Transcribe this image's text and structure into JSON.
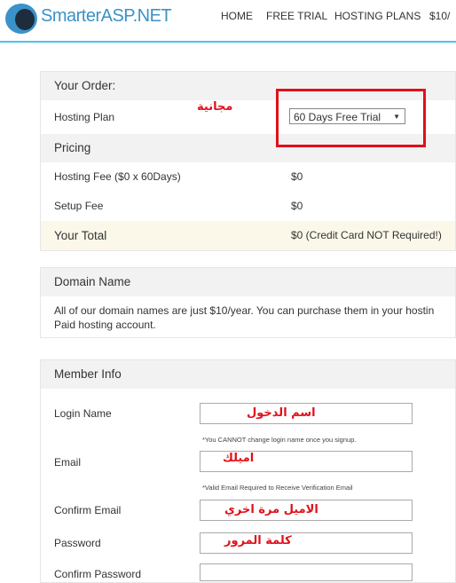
{
  "header": {
    "brand": "SmarterASP.NET",
    "nav": [
      "HOME",
      "FREE TRIAL",
      "HOSTING PLANS",
      "$10/"
    ]
  },
  "order": {
    "title": "Your Order:",
    "plan_label": "Hosting Plan",
    "plan_value": "60 Days Free Trial",
    "annotation": "مجانية"
  },
  "pricing": {
    "title": "Pricing",
    "rows": [
      {
        "label": "Hosting Fee ($0 x 60Days)",
        "value": "$0"
      },
      {
        "label": "Setup Fee",
        "value": "$0"
      }
    ],
    "total_label": "Your Total",
    "total_value": "$0 (Credit Card NOT Required!)"
  },
  "domain": {
    "title": "Domain Name",
    "text1": "All of our domain names are just $10/year. You can purchase them in your hostin",
    "text2": "Paid hosting account."
  },
  "member": {
    "title": "Member Info",
    "login_label": "Login Name",
    "login_value": "اسم الدخول",
    "login_note": "*You CANNOT change login name once you signup.",
    "email_label": "Email",
    "email_value": "اميلك",
    "email_note": "*Valid Email Required to Receive Verification Email",
    "confirm_email_label": "Confirm Email",
    "confirm_email_value": "الاميل مرة اخري",
    "password_label": "Password",
    "password_value": "كلمة المرور",
    "confirm_password_label": "Confirm Password",
    "confirm_password_value": ""
  },
  "colors": {
    "accent": "#4ec3e6",
    "annotation": "#e0101a",
    "brand": "#3a92c8"
  }
}
